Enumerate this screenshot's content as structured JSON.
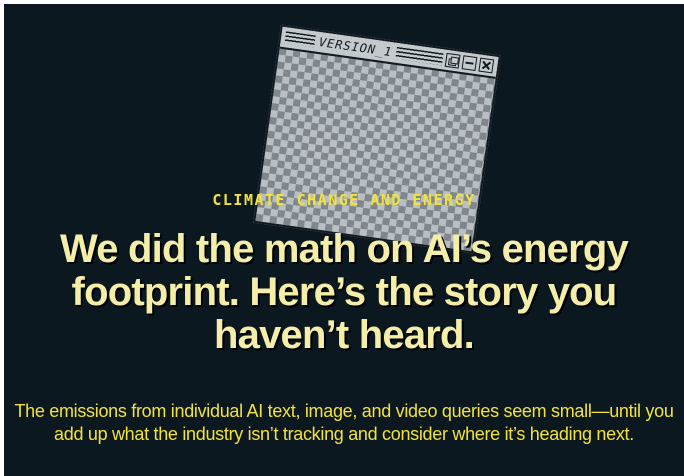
{
  "article": {
    "category": "CLIMATE CHANGE AND ENERGY",
    "headline": "We did the math on AI’s energy footprint. Here’s the story you haven’t heard.",
    "dek": "The emissions from individual AI text, image, and video queries seem small—until you add up what the industry isn’t tracking and consider where it’s heading next."
  },
  "illustration": {
    "window_title": "VERSION_1",
    "buttons": [
      "restore-icon",
      "minimize-icon",
      "close-icon"
    ]
  },
  "colors": {
    "background": "#0b1820",
    "kicker": "#f2e23e",
    "headline": "#f4eea8",
    "dek": "#f2e23e"
  }
}
